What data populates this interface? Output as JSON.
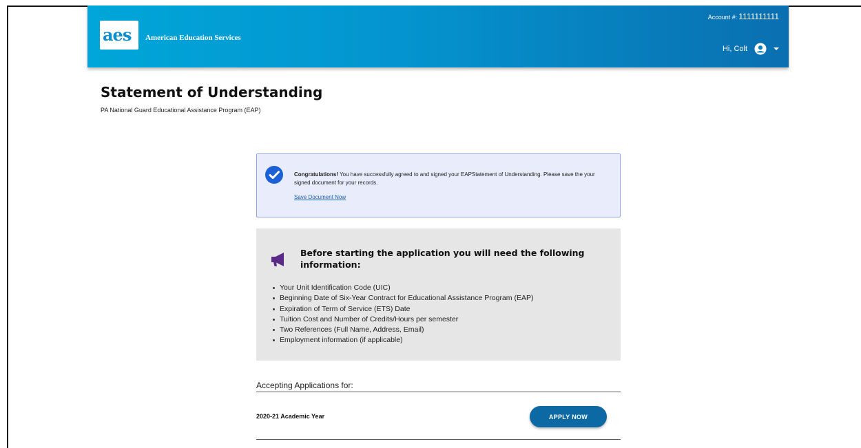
{
  "header": {
    "logo_text": "aes",
    "org_name": "American Education Services",
    "account_label": "Account #:",
    "account_number": "1111111111",
    "greeting": "Hi, Colt"
  },
  "page": {
    "title": "Statement of Understanding",
    "subtitle": "PA National Guard Educational Assistance Program (EAP)"
  },
  "alert": {
    "strong": "Congratulations!",
    "message": " You have successfully agreed to and signed your EAPStatement of Understanding. Please save the your signed document for your records.",
    "link": "Save Document Now"
  },
  "info": {
    "heading": "Before starting the application you will need the following information:",
    "items": [
      "Your Unit Identification Code (UIC)",
      "Beginning Date of Six-Year Contract for Educational Assistance Program (EAP)",
      "Expiration of Term of Service (ETS) Date",
      "Tuition Cost and Number of Credits/Hours per semester",
      "Two References (Full Name, Address, Email)",
      "Employment information (if applicable)"
    ]
  },
  "applications": {
    "label": "Accepting Applications for:",
    "year": "2020-21 Academic Year",
    "button": "APPLY NOW"
  },
  "icons": [
    "check-circle-icon",
    "megaphone-icon",
    "user-circle-icon",
    "caret-down-icon"
  ],
  "colors": {
    "header_start": "#00a6d9",
    "header_end": "#0a6fb0",
    "alert_bg": "#e8ecfb",
    "alert_border": "#93a6e6",
    "check": "#1c5fd6",
    "megaphone": "#5b2a86",
    "button": "#0c69a3"
  }
}
